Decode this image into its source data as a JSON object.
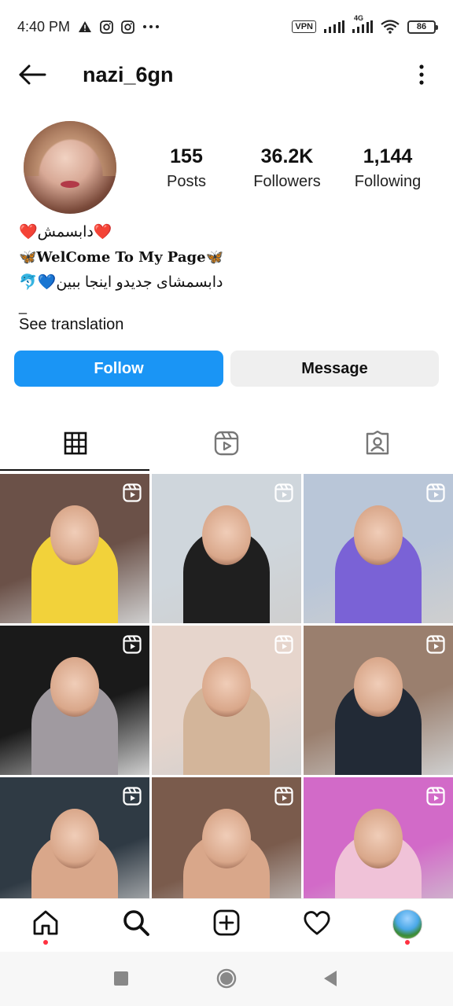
{
  "status_bar": {
    "time": "4:40 PM",
    "vpn": "VPN",
    "network": "4G",
    "battery": "86",
    "icons": [
      "warning-icon",
      "instagram-icon",
      "instagram-icon",
      "more-dots-icon",
      "vpn-icon",
      "signal-icon",
      "signal-4g-icon",
      "wifi-icon",
      "battery-icon"
    ]
  },
  "header": {
    "username": "nazi_6gn",
    "back_icon": "arrow-left-icon",
    "more_icon": "more-vertical-icon"
  },
  "profile": {
    "stats": [
      {
        "value": "155",
        "label": "Posts"
      },
      {
        "value": "36.2K",
        "label": "Followers"
      },
      {
        "value": "1,144",
        "label": "Following"
      }
    ],
    "bio": [
      "❤️دابسمش❤️",
      "🦋WelCome To My Page🦋",
      "🐬💙دابسمشای جدیدو اینجا ببین"
    ],
    "bio_dash": "_",
    "see_translation": "See translation"
  },
  "actions": {
    "follow": "Follow",
    "message": "Message"
  },
  "tabs": [
    {
      "icon": "grid-icon",
      "active": true
    },
    {
      "icon": "reels-icon",
      "active": false
    },
    {
      "icon": "tagged-icon",
      "active": false
    }
  ],
  "posts": [
    {
      "type": "reel",
      "bg": "#6b5148",
      "accent": "#f2d23a"
    },
    {
      "type": "reel",
      "bg": "#cfd6dc",
      "accent": "#1f1f1f"
    },
    {
      "type": "reel",
      "bg": "#b9c6d8",
      "accent": "#7a62d6"
    },
    {
      "type": "reel",
      "bg": "#1a1a1a",
      "accent": "#a09aa0"
    },
    {
      "type": "reel",
      "bg": "#e6d5cc",
      "accent": "#d3b59a"
    },
    {
      "type": "reel",
      "bg": "#9a7f6e",
      "accent": "#222a36"
    },
    {
      "type": "reel",
      "bg": "#2f3a44",
      "accent": "#d9a78a"
    },
    {
      "type": "reel",
      "bg": "#7a5b4c",
      "accent": "#d9a78a"
    },
    {
      "type": "reel",
      "bg": "#d26ac8",
      "accent": "#f0c2d8"
    }
  ],
  "bottom_nav": [
    "home-icon",
    "search-icon",
    "create-icon",
    "activity-heart-icon",
    "profile-avatar"
  ],
  "colors": {
    "follow_blue": "#1a95f5",
    "message_gray": "#efefef",
    "notification_red": "#ff3040"
  }
}
